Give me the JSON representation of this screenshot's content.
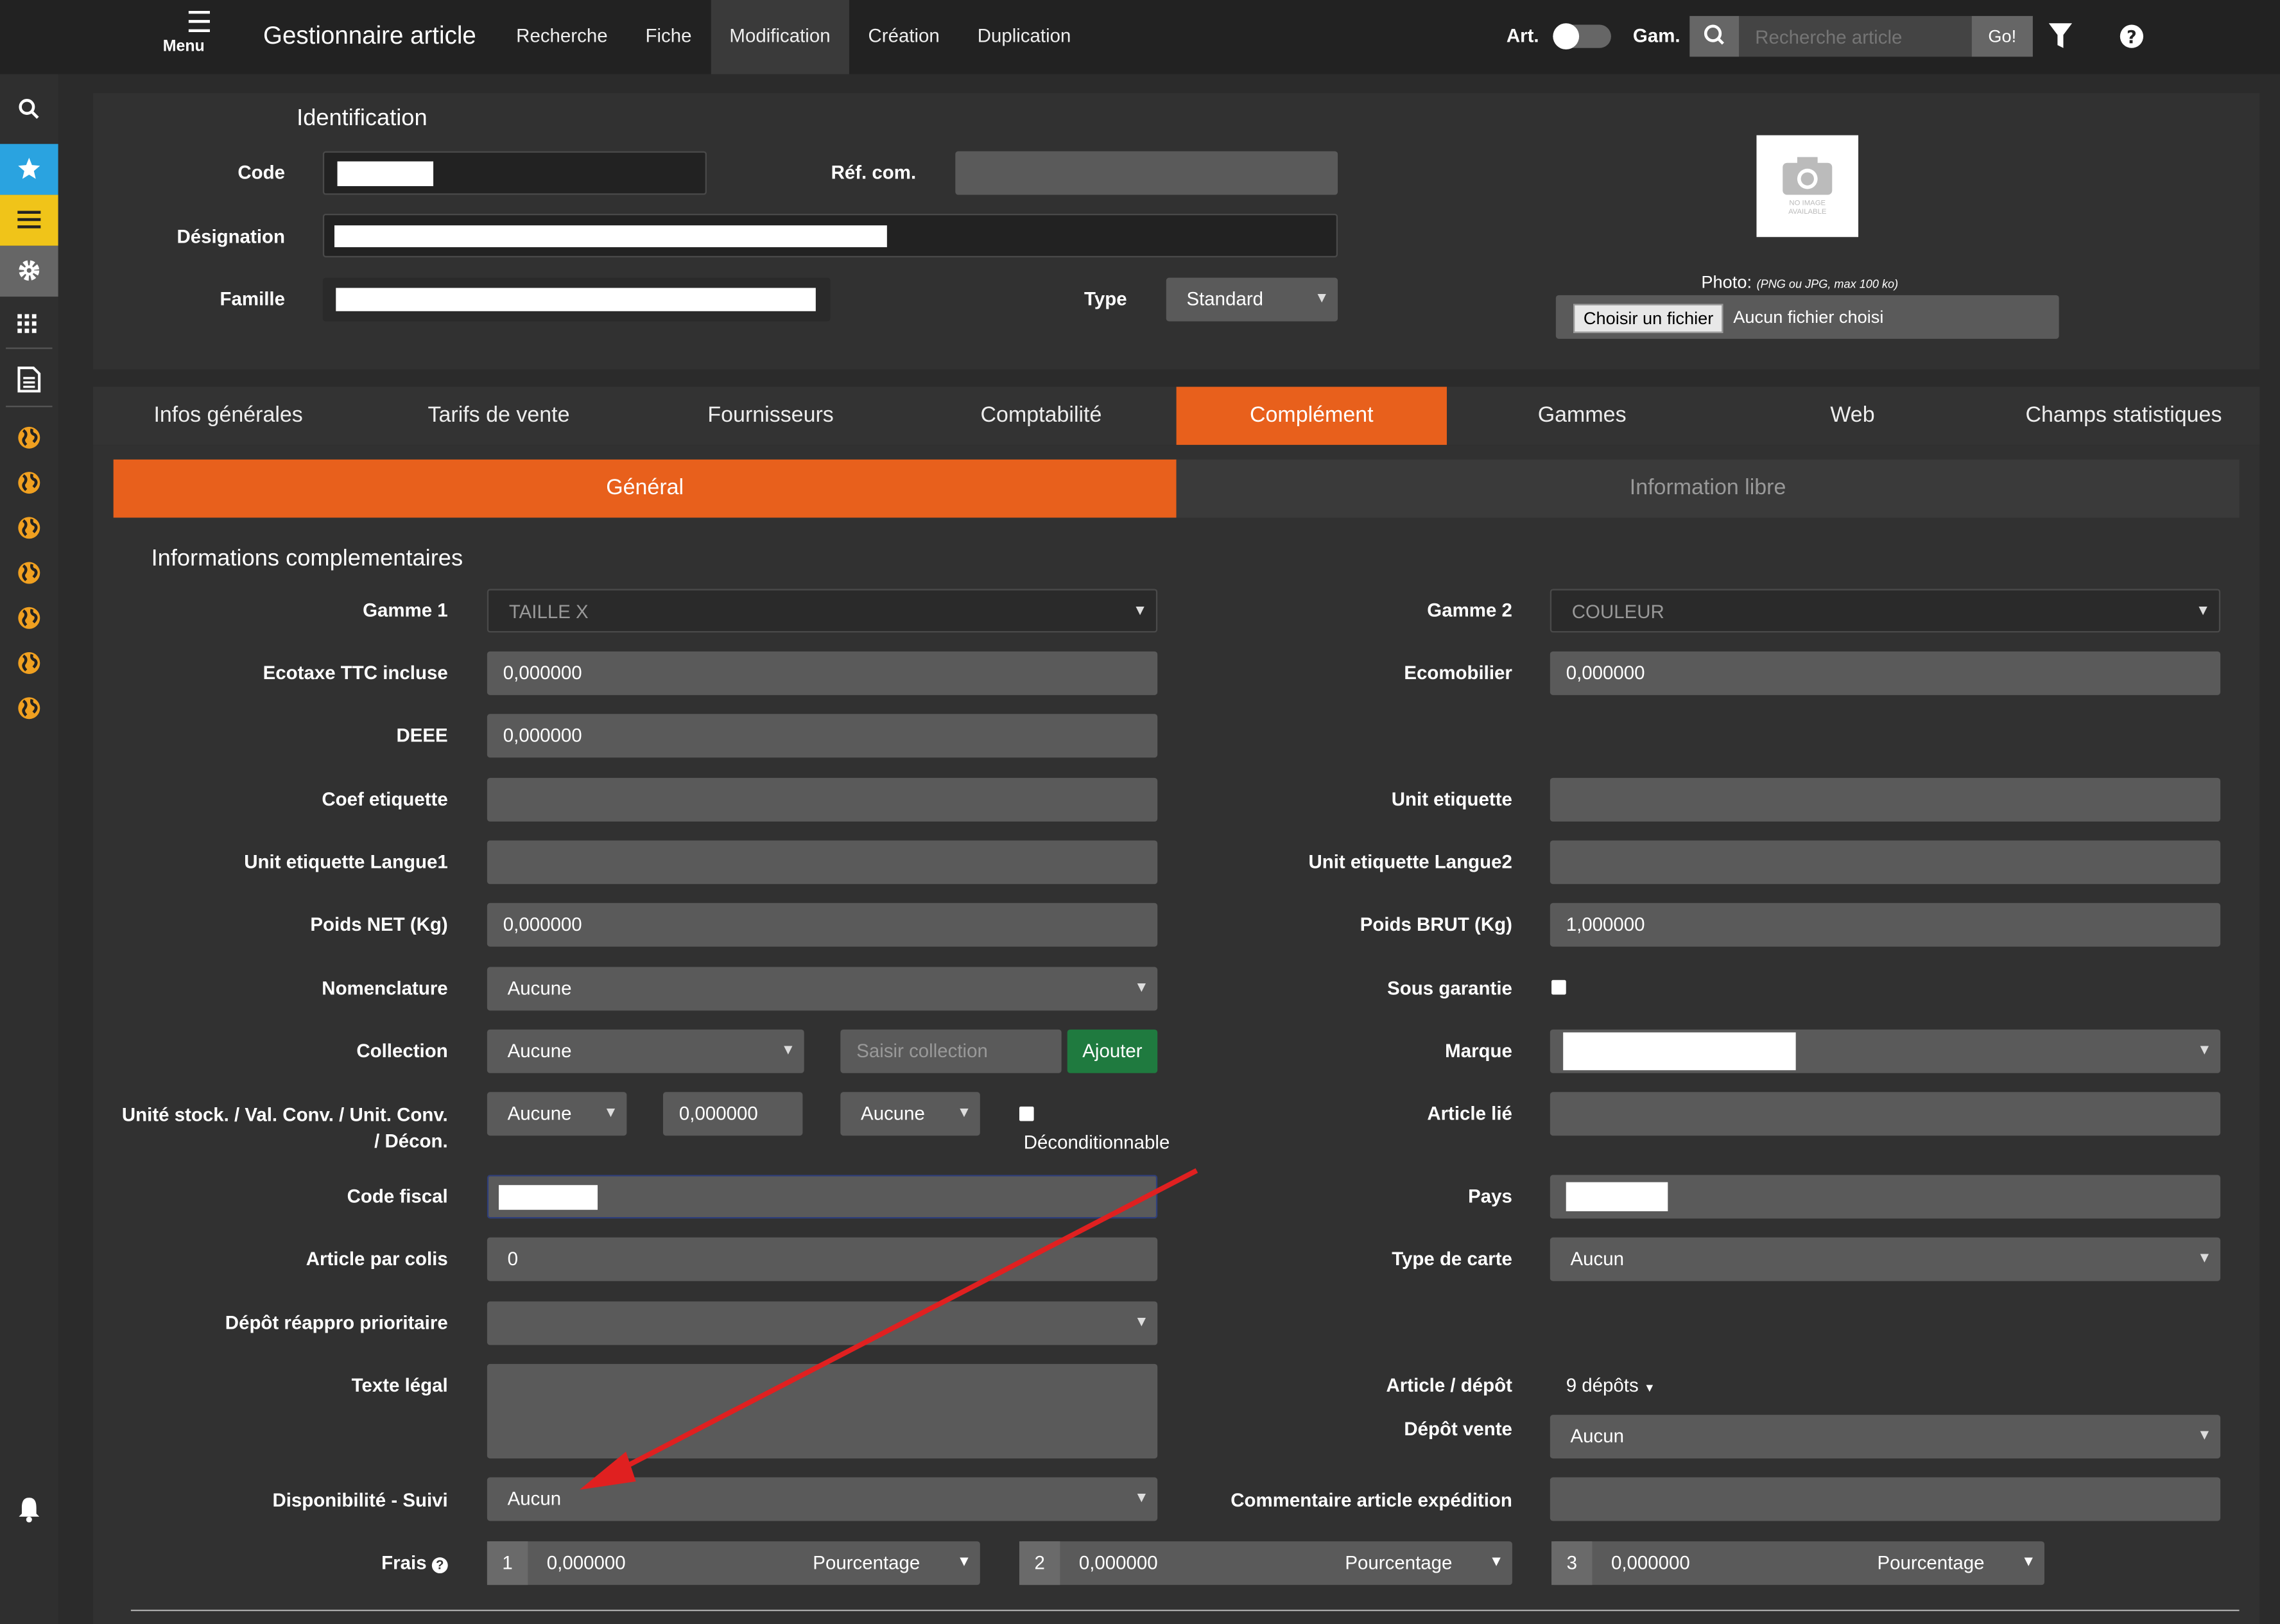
{
  "topbar": {
    "menu_label": "Menu",
    "app_title": "Gestionnaire article",
    "nav": [
      "Recherche",
      "Fiche",
      "Modification",
      "Création",
      "Duplication"
    ],
    "art_label": "Art.",
    "gam_label": "Gam.",
    "search_placeholder": "Recherche article",
    "go_label": "Go!"
  },
  "identification": {
    "title": "Identification",
    "code_label": "Code",
    "ref_label": "Réf. com.",
    "designation_label": "Désignation",
    "famille_label": "Famille",
    "type_label": "Type",
    "type_value": "Standard",
    "photo_label": "Photo:",
    "photo_hint": "(PNG ou JPG, max 100 ko)",
    "file_button": "Choisir un fichier",
    "file_status": "Aucun fichier choisi",
    "no_image_text": "NO IMAGE AVAILABLE"
  },
  "tabs": [
    "Infos générales",
    "Tarifs de vente",
    "Fournisseurs",
    "Comptabilité",
    "Complément",
    "Gammes",
    "Web",
    "Champs statistiques"
  ],
  "subtabs": [
    "Général",
    "Information libre"
  ],
  "section_title": "Informations complementaires",
  "form": {
    "gamme1_label": "Gamme 1",
    "gamme1_value": "TAILLE X",
    "gamme2_label": "Gamme 2",
    "gamme2_value": "COULEUR",
    "ecotaxe_label": "Ecotaxe TTC incluse",
    "ecotaxe_value": "0,000000",
    "ecomobilier_label": "Ecomobilier",
    "ecomobilier_value": "0,000000",
    "deee_label": "DEEE",
    "deee_value": "0,000000",
    "coef_label": "Coef etiquette",
    "unit_etiq_label": "Unit etiquette",
    "unit_l1_label": "Unit etiquette Langue1",
    "unit_l2_label": "Unit etiquette Langue2",
    "poids_net_label": "Poids NET (Kg)",
    "poids_net_value": "0,000000",
    "poids_brut_label": "Poids BRUT (Kg)",
    "poids_brut_value": "1,000000",
    "nomenclature_label": "Nomenclature",
    "nomenclature_value": "Aucune",
    "sous_garantie_label": "Sous garantie",
    "collection_label": "Collection",
    "collection_value": "Aucune",
    "collection_placeholder": "Saisir collection",
    "ajouter_label": "Ajouter",
    "marque_label": "Marque",
    "unite_label_1": "Unité stock. / Val. Conv. / Unit. Conv.",
    "unite_label_2": "/ Décon.",
    "unite_stock_value": "Aucune",
    "val_conv_value": "0,000000",
    "unit_conv_value": "Aucune",
    "decond_label": "Déconditionnable",
    "article_lie_label": "Article lié",
    "code_fiscal_label": "Code fiscal",
    "pays_label": "Pays",
    "article_colis_label": "Article par colis",
    "article_colis_value": "0",
    "type_carte_label": "Type de carte",
    "type_carte_value": "Aucun",
    "depot_reappro_label": "Dépôt réappro prioritaire",
    "texte_legal_label": "Texte légal",
    "article_depot_label": "Article / dépôt",
    "article_depot_value": "9 dépôts",
    "depot_vente_label": "Dépôt vente",
    "depot_vente_value": "Aucun",
    "dispo_label": "Disponibilité - Suivi",
    "dispo_value": "Aucun",
    "commentaire_label": "Commentaire article expédition",
    "frais_label": "Frais",
    "frais": [
      {
        "num": "1",
        "value": "0,000000",
        "type": "Pourcentage"
      },
      {
        "num": "2",
        "value": "0,000000",
        "type": "Pourcentage"
      },
      {
        "num": "3",
        "value": "0,000000",
        "type": "Pourcentage"
      }
    ]
  },
  "colors": {
    "accent": "#e8601c",
    "sidebar_star": "#2aa3e0",
    "sidebar_list": "#f0c419",
    "green": "#1f7a3f",
    "arrow": "#e02020"
  }
}
